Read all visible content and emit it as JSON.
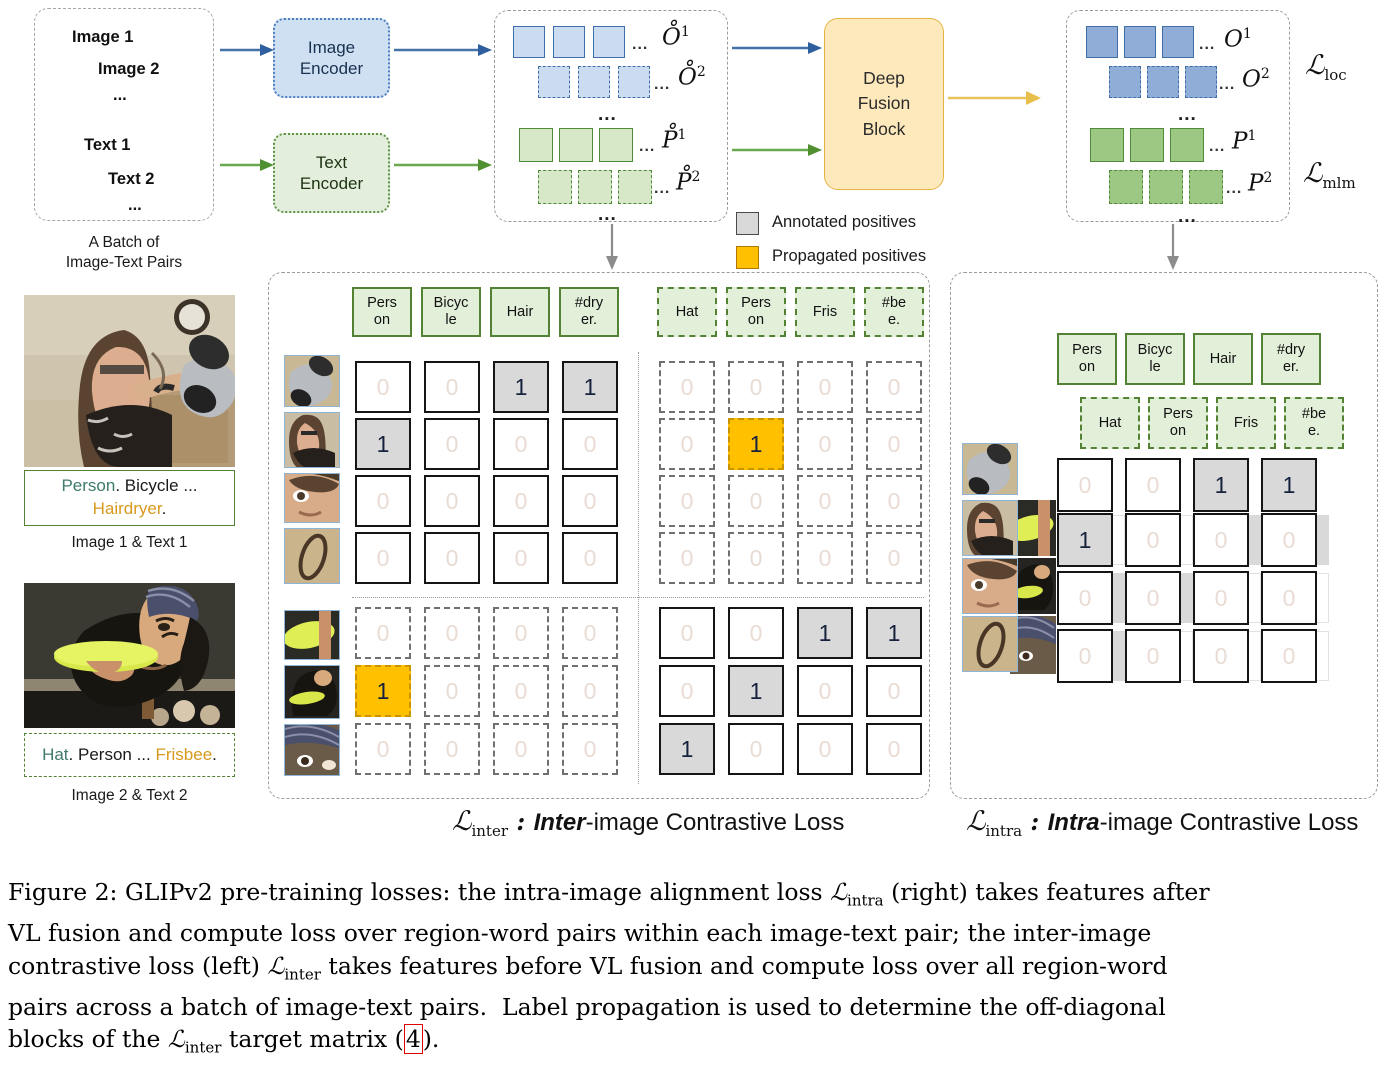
{
  "figure": {
    "number": "Figure 2:",
    "caption_lines": [
      "Figure 2: GLIPv2 pre-training losses: the intra-image alignment loss ℒintra (right) takes features after",
      "VL fusion and compute loss over region-word pairs within each image-text pair; the inter-image",
      "contrastive loss (left) ℒinter takes features before VL fusion and compute loss over all region-word",
      "pairs across a batch of image-text pairs.  Label propagation is used to determine the off-diagonal",
      "blocks of the ℒinter target matrix (4)."
    ],
    "reference_number": "4"
  },
  "batch": {
    "lines": [
      "Image 1",
      "Image 2",
      "...",
      "Text 1",
      "Text 2",
      "..."
    ],
    "caption_line1": "A Batch of",
    "caption_line2": "Image-Text Pairs"
  },
  "encoders": {
    "image": {
      "line1": "Image",
      "line2": "Encoder"
    },
    "text": {
      "line1": "Text",
      "line2": "Encoder"
    }
  },
  "fusion": {
    "line1": "Deep",
    "line2": "Fusion",
    "line3": "Block"
  },
  "prefusion_features": {
    "rows": [
      {
        "symbol": "O",
        "sup": "1",
        "ring": true,
        "ellipsis": "..."
      },
      {
        "symbol": "O",
        "sup": "2",
        "ring": true,
        "ellipsis": "..."
      },
      {
        "symbol": "P",
        "sup": "1",
        "ring": true,
        "ellipsis": "..."
      },
      {
        "symbol": "P",
        "sup": "2",
        "ring": true,
        "ellipsis": "..."
      }
    ],
    "vertical_ellipsis": "..."
  },
  "postfusion_features": {
    "rows": [
      {
        "symbol": "O",
        "sup": "1",
        "ellipsis": "..."
      },
      {
        "symbol": "O",
        "sup": "2",
        "ellipsis": "..."
      },
      {
        "symbol": "P",
        "sup": "1",
        "ellipsis": "..."
      },
      {
        "symbol": "P",
        "sup": "2",
        "ellipsis": "..."
      }
    ],
    "vertical_ellipsis": "..."
  },
  "losses": {
    "loc": {
      "symbol": "ℒ",
      "sub": "loc"
    },
    "mlm": {
      "symbol": "ℒ",
      "sub": "mlm"
    }
  },
  "legend": {
    "items": [
      {
        "label": "Annotated positives",
        "color": "#d9d9d9",
        "border": "#4a4a4a"
      },
      {
        "label": "Propagated positives",
        "color": "#ffc000",
        "border": "#b07800"
      }
    ]
  },
  "examples": [
    {
      "index": 1,
      "caption": "Image 1 & Text 1",
      "text_parts": [
        {
          "t": "Person",
          "style": "green"
        },
        {
          "t": ". Bicycle ...",
          "style": "plain"
        },
        {
          "t": "Hairdryer",
          "style": "orange"
        },
        {
          "t": ".",
          "style": "plain"
        }
      ],
      "border_style": "solid"
    },
    {
      "index": 2,
      "caption": "Image 2 & Text 2",
      "text_parts": [
        {
          "t": "Hat",
          "style": "green"
        },
        {
          "t": ". Person ... ",
          "style": "plain"
        },
        {
          "t": "Frisbee",
          "style": "orange"
        },
        {
          "t": ".",
          "style": "plain"
        }
      ],
      "border_style": "dashed"
    }
  ],
  "inter_panel": {
    "title": {
      "L": "ℒ",
      "sub": "inter",
      "colon": " : ",
      "bold": "Inter",
      "rest": "-image Contrastive Loss"
    },
    "word_groups": [
      {
        "style": "solid",
        "tokens": [
          {
            "l1": "Pers",
            "l2": "on"
          },
          {
            "l1": "Bicyc",
            "l2": "le"
          },
          {
            "l1": "Hair",
            "l2": ""
          },
          {
            "l1": "#dry",
            "l2": "er."
          }
        ]
      },
      {
        "style": "dashed",
        "tokens": [
          {
            "l1": "Hat",
            "l2": ""
          },
          {
            "l1": "Pers",
            "l2": "on"
          },
          {
            "l1": "Fris",
            "l2": ""
          },
          {
            "l1": "#be",
            "l2": "e."
          }
        ]
      }
    ],
    "quadrants": {
      "top_left": {
        "style": "solid",
        "values": [
          [
            0,
            0,
            1,
            1
          ],
          [
            1,
            0,
            0,
            0
          ],
          [
            0,
            0,
            0,
            0
          ],
          [
            0,
            0,
            0,
            0
          ]
        ],
        "positive": "annotated"
      },
      "top_right": {
        "style": "dashed",
        "values": [
          [
            0,
            0,
            0,
            0
          ],
          [
            0,
            1,
            0,
            0
          ],
          [
            0,
            0,
            0,
            0
          ],
          [
            0,
            0,
            0,
            0
          ]
        ],
        "positive": "propagated"
      },
      "bottom_left": {
        "style": "dashed",
        "values": [
          [
            0,
            0,
            0,
            0
          ],
          [
            1,
            0,
            0,
            0
          ],
          [
            0,
            0,
            0,
            0
          ]
        ],
        "positive": "propagated"
      },
      "bottom_right": {
        "style": "solid",
        "values": [
          [
            0,
            0,
            1,
            1
          ],
          [
            0,
            1,
            0,
            0
          ],
          [
            1,
            0,
            0,
            0
          ]
        ],
        "positive": "annotated"
      }
    }
  },
  "intra_panel": {
    "title": {
      "L": "ℒ",
      "sub": "intra",
      "colon": " : ",
      "bold": "Intra",
      "rest": "-image Contrastive Loss"
    },
    "word_groups": [
      {
        "style": "solid",
        "tokens": [
          {
            "l1": "Pers",
            "l2": "on"
          },
          {
            "l1": "Bicyc",
            "l2": "le"
          },
          {
            "l1": "Hair",
            "l2": ""
          },
          {
            "l1": "#dry",
            "l2": "er."
          }
        ]
      },
      {
        "style": "dashed",
        "tokens": [
          {
            "l1": "Hat",
            "l2": ""
          },
          {
            "l1": "Pers",
            "l2": "on"
          },
          {
            "l1": "Fris",
            "l2": ""
          },
          {
            "l1": "#be",
            "l2": "e."
          }
        ]
      }
    ],
    "front_matrix": {
      "values": [
        [
          0,
          0,
          1,
          1
        ],
        [
          1,
          0,
          0,
          0
        ],
        [
          0,
          0,
          0,
          0
        ],
        [
          0,
          0,
          0,
          0
        ]
      ],
      "positive": "annotated"
    },
    "back_matrix": {
      "values": [
        [
          0,
          0,
          0,
          0
        ],
        [
          0,
          0,
          0,
          0
        ],
        [
          0,
          0,
          0,
          0
        ]
      ],
      "note": "ghost layer behind front matrix"
    }
  }
}
